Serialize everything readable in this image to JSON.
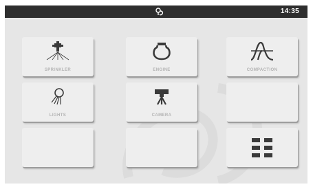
{
  "status_bar": {
    "time": "14:35",
    "logo_icon": "brand-logo-icon",
    "background": "#2e2e2e"
  },
  "tiles": [
    {
      "label": "SPRINKLER",
      "icon": "sprinkler-icon"
    },
    {
      "label": "ENGINE",
      "icon": "engine-icon"
    },
    {
      "label": "COMPACTION",
      "icon": "compaction-wave-icon"
    },
    {
      "label": "LIGHTS",
      "icon": "lights-icon"
    },
    {
      "label": "CAMERA",
      "icon": "camera-icon"
    },
    {
      "label": "",
      "icon": ""
    },
    {
      "label": "",
      "icon": ""
    },
    {
      "label": "",
      "icon": ""
    },
    {
      "label": "",
      "icon": "grid-menu-icon"
    }
  ],
  "colors": {
    "screen_background": "#e6e6e6",
    "tile_background": "#eeeeee",
    "icon": "#3a3a3a",
    "label": "#b3b3b3"
  }
}
